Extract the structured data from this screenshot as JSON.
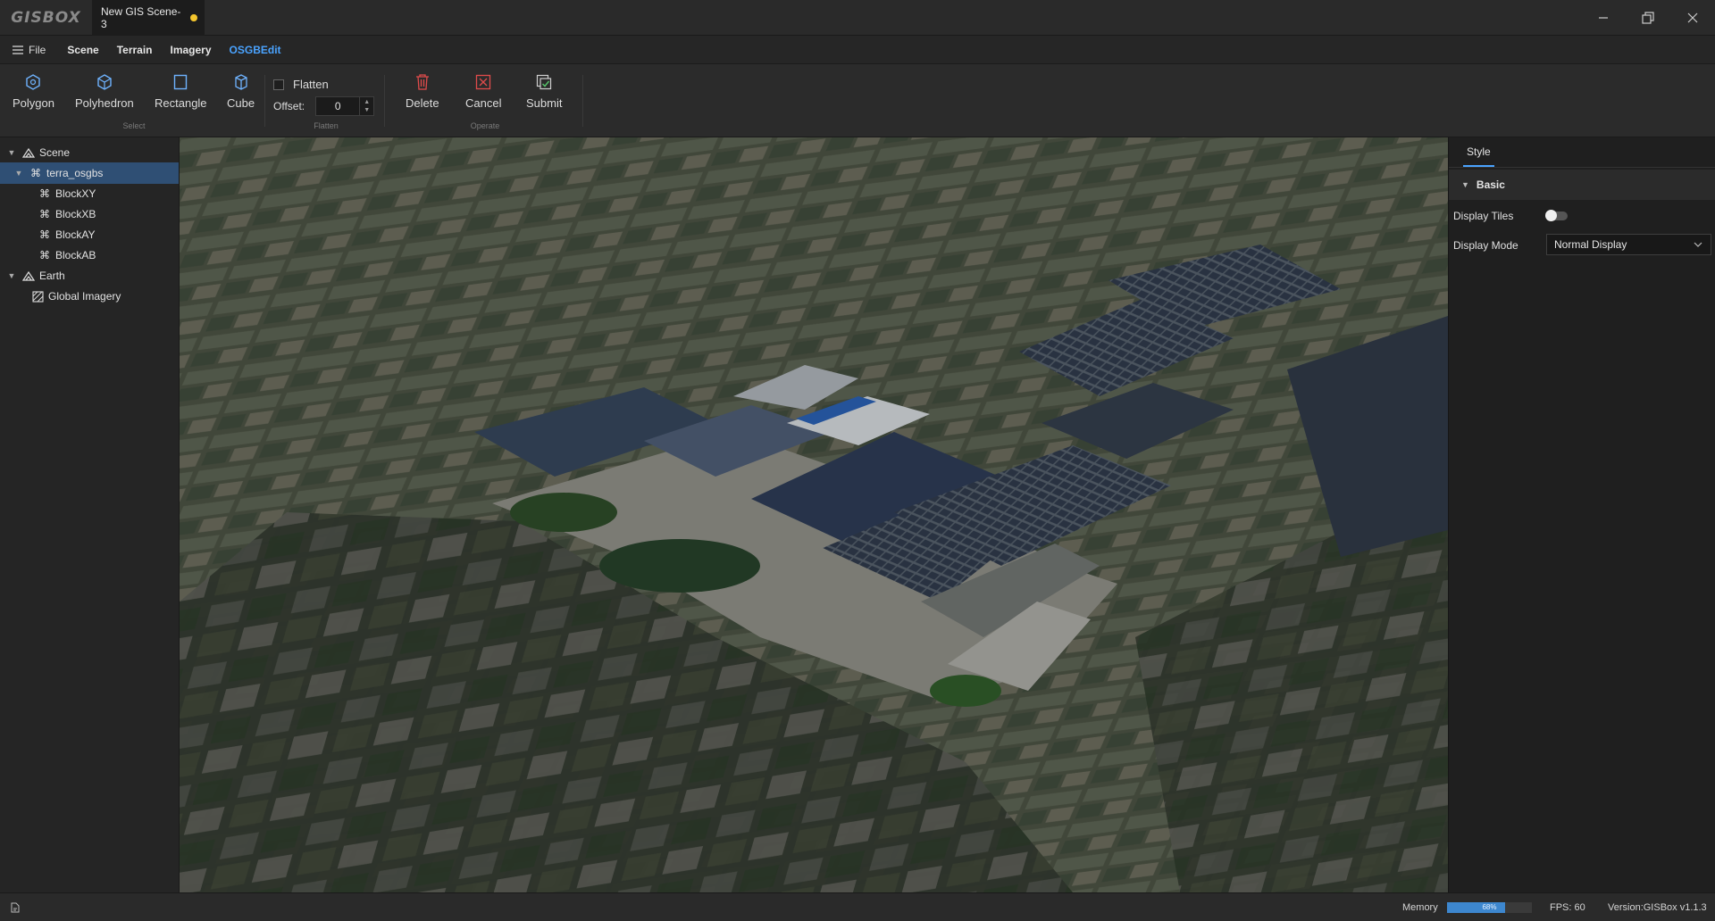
{
  "app": {
    "logo": "GISBOX",
    "doc_tab": "New GIS Scene-3"
  },
  "menu": {
    "file": "File",
    "items": [
      "Scene",
      "Terrain",
      "Imagery",
      "OSGBEdit"
    ],
    "active_index": 3
  },
  "toolbar": {
    "select_group": {
      "label": "Select",
      "buttons": [
        "Polygon",
        "Polyhedron",
        "Rectangle",
        "Cube"
      ]
    },
    "flatten_group": {
      "label": "Flatten",
      "checkbox_label": "Flatten",
      "offset_label": "Offset:",
      "offset_value": "0"
    },
    "operate_group": {
      "label": "Operate",
      "buttons": [
        "Delete",
        "Cancel",
        "Submit"
      ]
    }
  },
  "tree": {
    "scene": "Scene",
    "terra": "terra_osgbs",
    "blocks": [
      "BlockXY",
      "BlockXB",
      "BlockAY",
      "BlockAB"
    ],
    "earth": "Earth",
    "imagery": "Global Imagery"
  },
  "properties": {
    "tab": "Style",
    "section": "Basic",
    "display_tiles_label": "Display Tiles",
    "display_tiles_on": false,
    "display_mode_label": "Display Mode",
    "display_mode_value": "Normal Display"
  },
  "status": {
    "memory_label": "Memory",
    "memory_percent": 68,
    "memory_text": "68%",
    "fps": "FPS: 60",
    "version": "Version:GISBox v1.1.3"
  },
  "colors": {
    "accent": "#4aa3ff",
    "selection": "#2f4f74",
    "memory_fill": "#3d87cf",
    "unsaved_dot": "#f3c52d",
    "delete_icon": "#e04b4b",
    "cancel_icon": "#e04b4b",
    "submit_icon": "#56c26a"
  }
}
